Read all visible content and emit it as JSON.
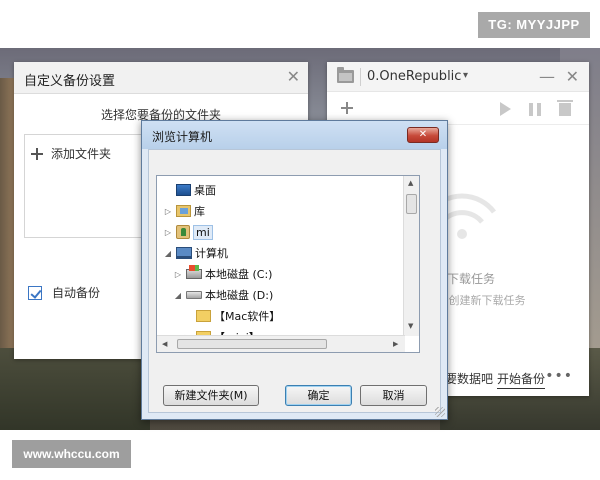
{
  "watermarks": {
    "top_right": "TG: MYYJJPP",
    "bottom_left": "www.whccu.com"
  },
  "backup_settings_window": {
    "title": "自定义备份设置",
    "close_glyph": "✕",
    "prompt": "选择您要备份的文件夹",
    "add_folder_label": "添加文件夹",
    "auto_backup_label": "自动备份",
    "auto_backup_checked": true
  },
  "download_window": {
    "title": "0.OneRepublic",
    "caret": "▾",
    "minimize_glyph": "—",
    "close_glyph": "✕",
    "empty_title": "下载任务",
    "empty_hint": "*创建新下载任务",
    "restore_link": "要数据吧",
    "start_backup_link": "开始备份",
    "more_glyph": "•••"
  },
  "browse_dialog": {
    "title": "浏览计算机",
    "close_glyph": "✕",
    "tree": [
      {
        "label": "桌面",
        "arrow": "",
        "icon": "desktop-icon"
      },
      {
        "label": "库",
        "arrow": "▷",
        "icon": "library-icon"
      },
      {
        "label": "mi",
        "arrow": "▷",
        "icon": "user-folder-icon",
        "selected": true
      },
      {
        "label": "计算机",
        "arrow": "◢",
        "icon": "computer-icon"
      },
      {
        "label": "本地磁盘 (C:)",
        "arrow": "▷",
        "icon": "system-drive-icon"
      },
      {
        "label": "本地磁盘 (D:)",
        "arrow": "◢",
        "icon": "drive-icon"
      },
      {
        "label": "【Mac软件】",
        "arrow": "",
        "icon": "folder-icon"
      },
      {
        "label": "【miui】",
        "arrow": "▷",
        "icon": "folder-icon"
      }
    ],
    "new_folder_button": "新建文件夹(M)",
    "ok_button": "确定",
    "cancel_button": "取消"
  },
  "colors": {
    "dialog_frame": "#dfe9f5",
    "close_red": "#c74a3a",
    "checkbox_blue": "#3b76c4"
  }
}
